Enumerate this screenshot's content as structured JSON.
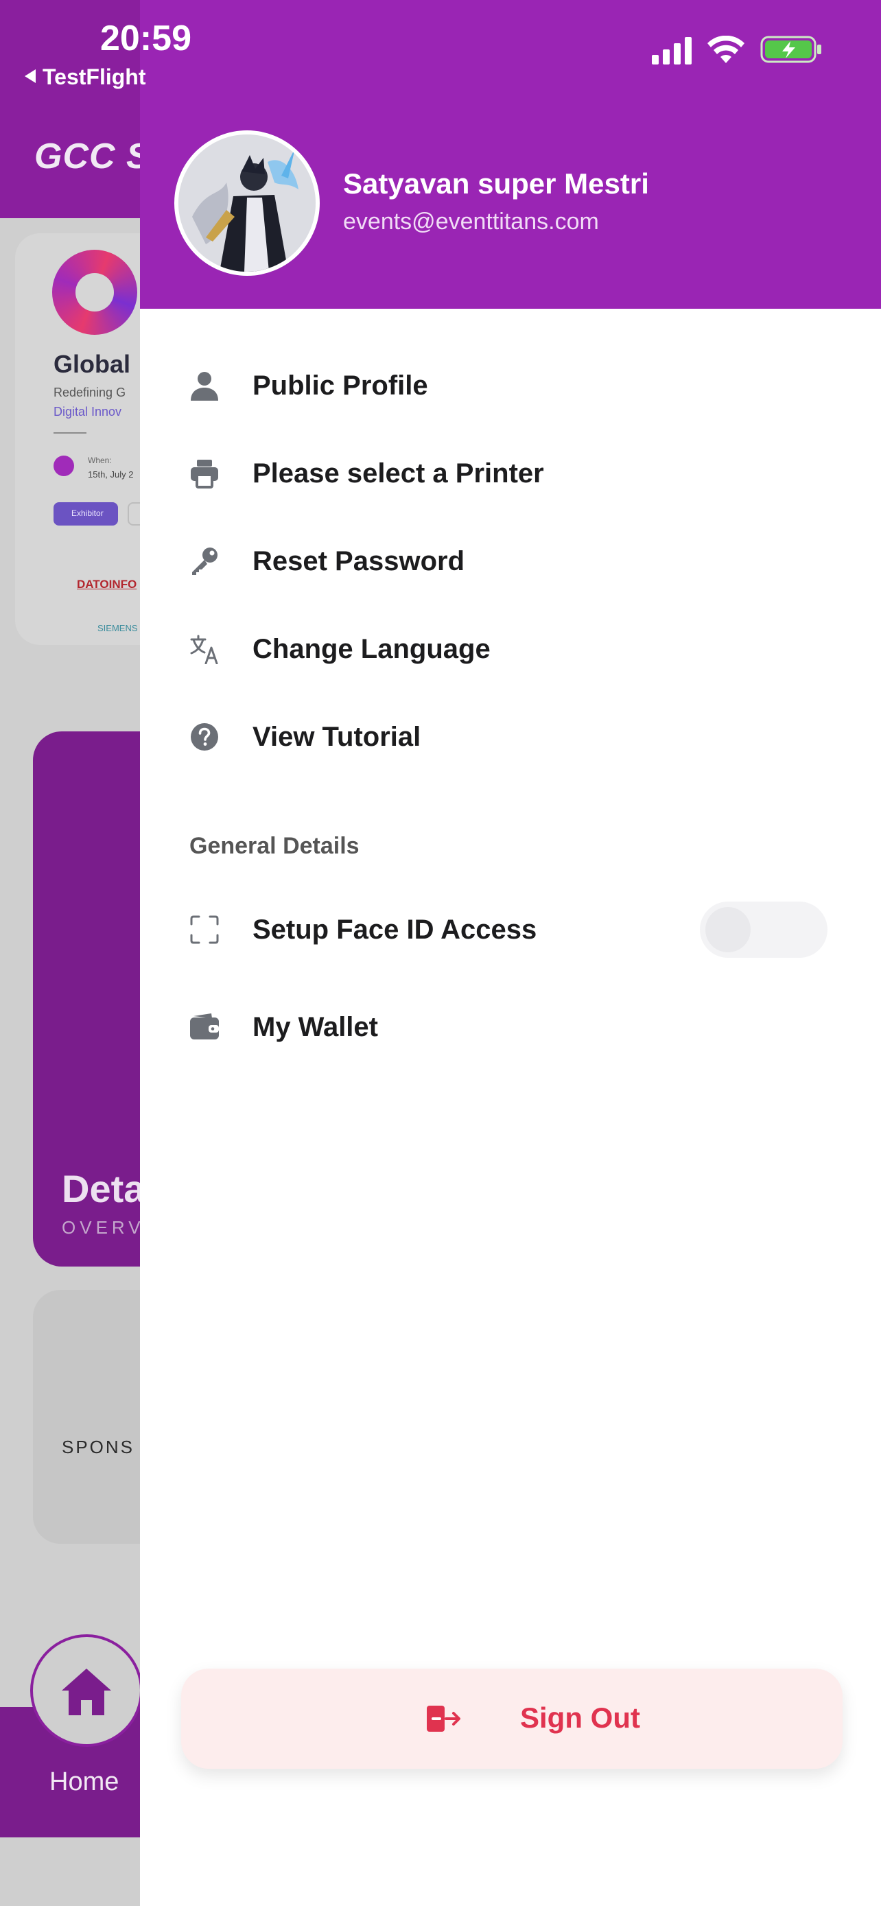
{
  "status_bar": {
    "time": "20:59",
    "back_label": "TestFlight"
  },
  "background": {
    "app_title": "GCC S",
    "event_name": "Global",
    "event_tagline_1": "Redefining G",
    "event_tagline_2": "Digital Innov",
    "when_label": "When:",
    "when_value": "15th, July 2",
    "chip_label": "Exhibitor",
    "sponsor_logo_1": "DATOINFO",
    "sponsor_logo_2": "SIEMENS",
    "details_title": "Deta",
    "details_subtitle": "OVERV",
    "sponsors_label": "SPONS",
    "tab_home_label": "Home"
  },
  "drawer": {
    "user": {
      "name": "Satyavan super Mestri",
      "email": "events@eventtitans.com"
    },
    "menu_items": [
      {
        "label": "Public Profile",
        "icon": "person-icon"
      },
      {
        "label": "Please select a Printer",
        "icon": "printer-icon"
      },
      {
        "label": "Reset Password",
        "icon": "key-icon"
      },
      {
        "label": "Change Language",
        "icon": "translate-icon"
      },
      {
        "label": "View Tutorial",
        "icon": "help-circle-icon"
      }
    ],
    "section_title": "General Details",
    "general_items": [
      {
        "label": "Setup Face ID Access",
        "icon": "face-id-icon",
        "toggle_on": false
      },
      {
        "label": "My Wallet",
        "icon": "wallet-icon"
      }
    ],
    "sign_out_label": "Sign Out",
    "colors": {
      "header": "#9a25b4",
      "sign_out_text": "#e0334f",
      "sign_out_bg": "#fdeded"
    }
  }
}
